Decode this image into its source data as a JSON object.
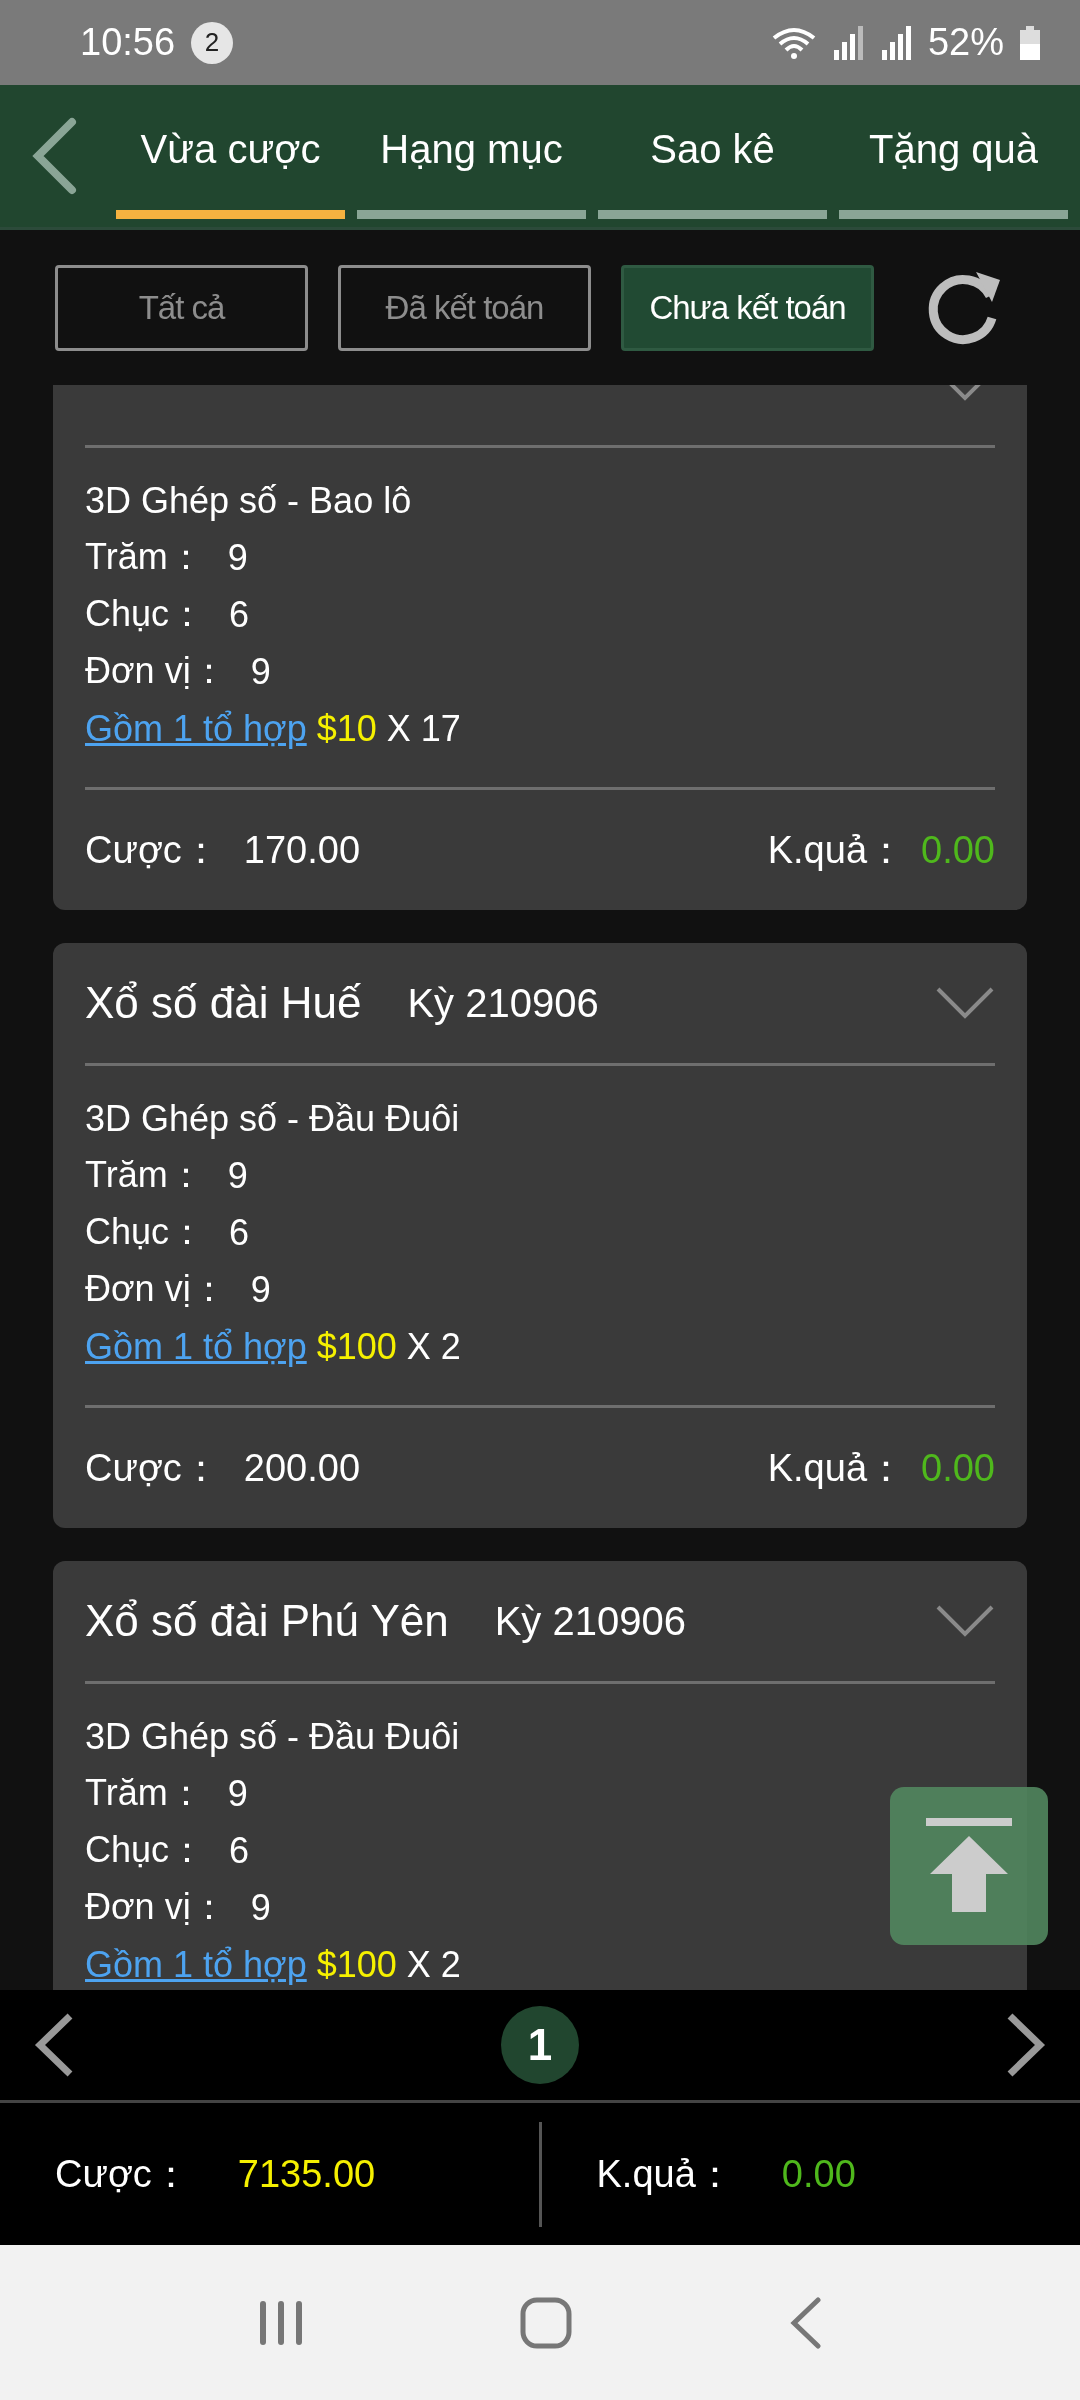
{
  "status_bar": {
    "time": "10:56",
    "notification_count": "2",
    "battery": "52%"
  },
  "tabs": [
    {
      "label": "Vừa cược",
      "selected": true
    },
    {
      "label": "Hạng mục",
      "selected": false
    },
    {
      "label": "Sao kê",
      "selected": false
    },
    {
      "label": "Tặng quà",
      "selected": false
    }
  ],
  "filters": [
    {
      "label": "Tất cả",
      "selected": false
    },
    {
      "label": "Đã kết toán",
      "selected": false
    },
    {
      "label": "Chưa kết toán",
      "selected": true
    }
  ],
  "bets": [
    {
      "game": "3D Ghép số - Bao lô",
      "digits": [
        {
          "label": "Trăm：",
          "value": "9"
        },
        {
          "label": "Chục：",
          "value": "6"
        },
        {
          "label": "Đơn vị：",
          "value": "9"
        }
      ],
      "combo_link": "Gồm 1 tổ hợp",
      "stake": "$10",
      "multiplier": "X 17",
      "bet_label": "Cược：",
      "bet": "170.00",
      "result_label": "K.quả：",
      "result": "0.00"
    },
    {
      "lottery": "Xổ số đài Huế",
      "period": "Kỳ 210906",
      "game": "3D Ghép số - Đầu Đuôi",
      "digits": [
        {
          "label": "Trăm：",
          "value": "9"
        },
        {
          "label": "Chục：",
          "value": "6"
        },
        {
          "label": "Đơn vị：",
          "value": "9"
        }
      ],
      "combo_link": "Gồm 1 tổ hợp",
      "stake": "$100",
      "multiplier": "X 2",
      "bet_label": "Cược：",
      "bet": "200.00",
      "result_label": "K.quả：",
      "result": "0.00"
    },
    {
      "lottery": "Xổ số đài Phú Yên",
      "period": "Kỳ 210906",
      "game": "3D Ghép số - Đầu Đuôi",
      "digits": [
        {
          "label": "Trăm：",
          "value": "9"
        },
        {
          "label": "Chục：",
          "value": "6"
        },
        {
          "label": "Đơn vị：",
          "value": "9"
        }
      ],
      "combo_link": "Gồm 1 tổ hợp",
      "stake": "$100",
      "multiplier": "X 2"
    }
  ],
  "pagination": {
    "current_page": "1"
  },
  "totals": {
    "bet_label": "Cược：",
    "bet": "7135.00",
    "result_label": "K.quả：",
    "result": "0.00"
  }
}
